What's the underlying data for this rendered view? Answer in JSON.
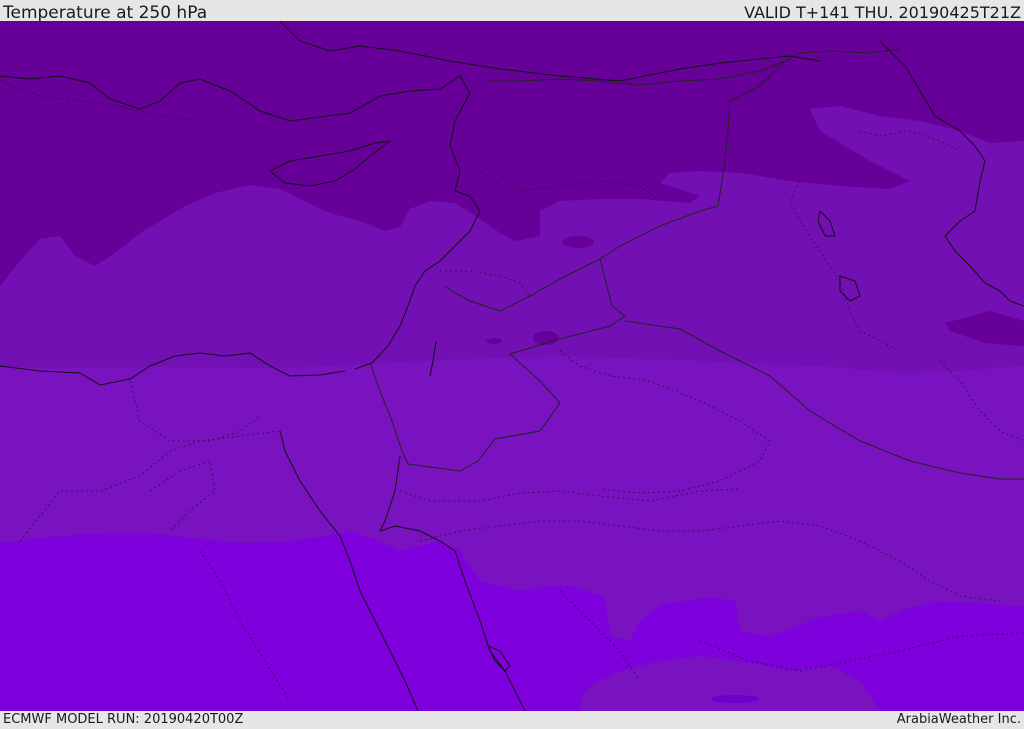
{
  "header": {
    "title": "Temperature at 250 hPa",
    "valid_time": "VALID T+141 THU. 20190425T21Z"
  },
  "footer": {
    "model_run": "ECMWF MODEL RUN: 20190420T00Z",
    "credit": "ArabiaWeather Inc."
  },
  "map": {
    "variable": "Temperature",
    "level": "250 hPa",
    "colors": {
      "coldest": "#660099",
      "cold": "#7310b3",
      "mid": "#7913bf",
      "warm": "#7e00dc",
      "coastline": "#111111",
      "border": "#222222"
    }
  }
}
